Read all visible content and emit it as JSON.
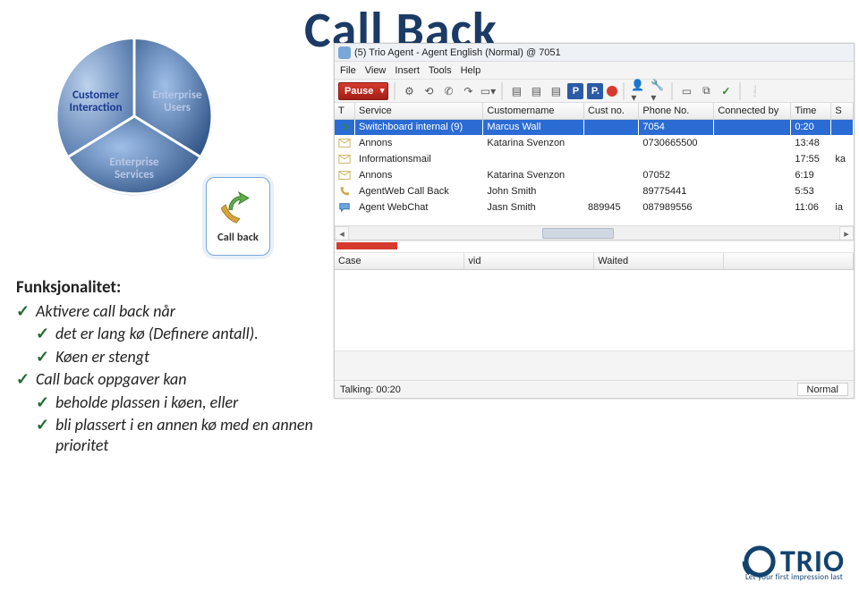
{
  "title": "Call Back",
  "pie": {
    "ci_line1": "Customer",
    "ci_line2": "Interaction",
    "eu_line1": "Enterprise",
    "eu_line2": "Users",
    "es_line1": "Enterprise",
    "es_line2": "Services"
  },
  "callback_box": {
    "label": "Call back"
  },
  "app": {
    "title": "(5) Trio Agent - Agent English (Normal) @ 7051",
    "menus": [
      "File",
      "View",
      "Insert",
      "Tools",
      "Help"
    ],
    "pause": "Pause",
    "columns": [
      "T",
      "Service",
      "Customername",
      "Cust no.",
      "Phone No.",
      "Connected by",
      "Time",
      "S"
    ],
    "rows": [
      {
        "icon": "arrow",
        "service": "Switchboard internal (9)",
        "cust": "Marcus Wall",
        "no": "",
        "phone": "7054",
        "conn": "",
        "time": "0:20",
        "s": "",
        "sel": true
      },
      {
        "icon": "envelope",
        "service": "Annons",
        "cust": "Katarina Svenzon",
        "no": "",
        "phone": "0730665500",
        "conn": "",
        "time": "13:48",
        "s": ""
      },
      {
        "icon": "envelope",
        "service": "Informationsmail",
        "cust": "",
        "no": "",
        "phone": "",
        "conn": "",
        "time": "17:55",
        "s": "ka"
      },
      {
        "icon": "envelope",
        "service": "Annons",
        "cust": "Katarina Svenzon",
        "no": "",
        "phone": "07052",
        "conn": "",
        "time": "6:19",
        "s": ""
      },
      {
        "icon": "phone",
        "service": "AgentWeb Call Back",
        "cust": "John Smith",
        "no": "",
        "phone": "89775441",
        "conn": "",
        "time": "5:53",
        "s": ""
      },
      {
        "icon": "chat",
        "service": "Agent WebChat",
        "cust": "Jasn Smith",
        "no": "889945",
        "phone": "087989556",
        "conn": "",
        "time": "11:06",
        "s": "ia"
      }
    ],
    "detail_cols": [
      "Case",
      "vid",
      "Waited"
    ],
    "status_left": "Talking: 00:20",
    "status_right": "Normal"
  },
  "text": {
    "heading": "Funksjonalitet:",
    "i1": "Aktivere call back når",
    "i1a": "det er lang kø (Definere antall).",
    "i1b": "Køen er stengt",
    "i2": "Call back oppgaver kan",
    "i2a": "beholde plassen i køen, eller",
    "i2b": "bli plassert i en annen kø med en annen prioritet"
  },
  "logo": {
    "name": "TRIO",
    "tag": "Let your first impression last"
  }
}
